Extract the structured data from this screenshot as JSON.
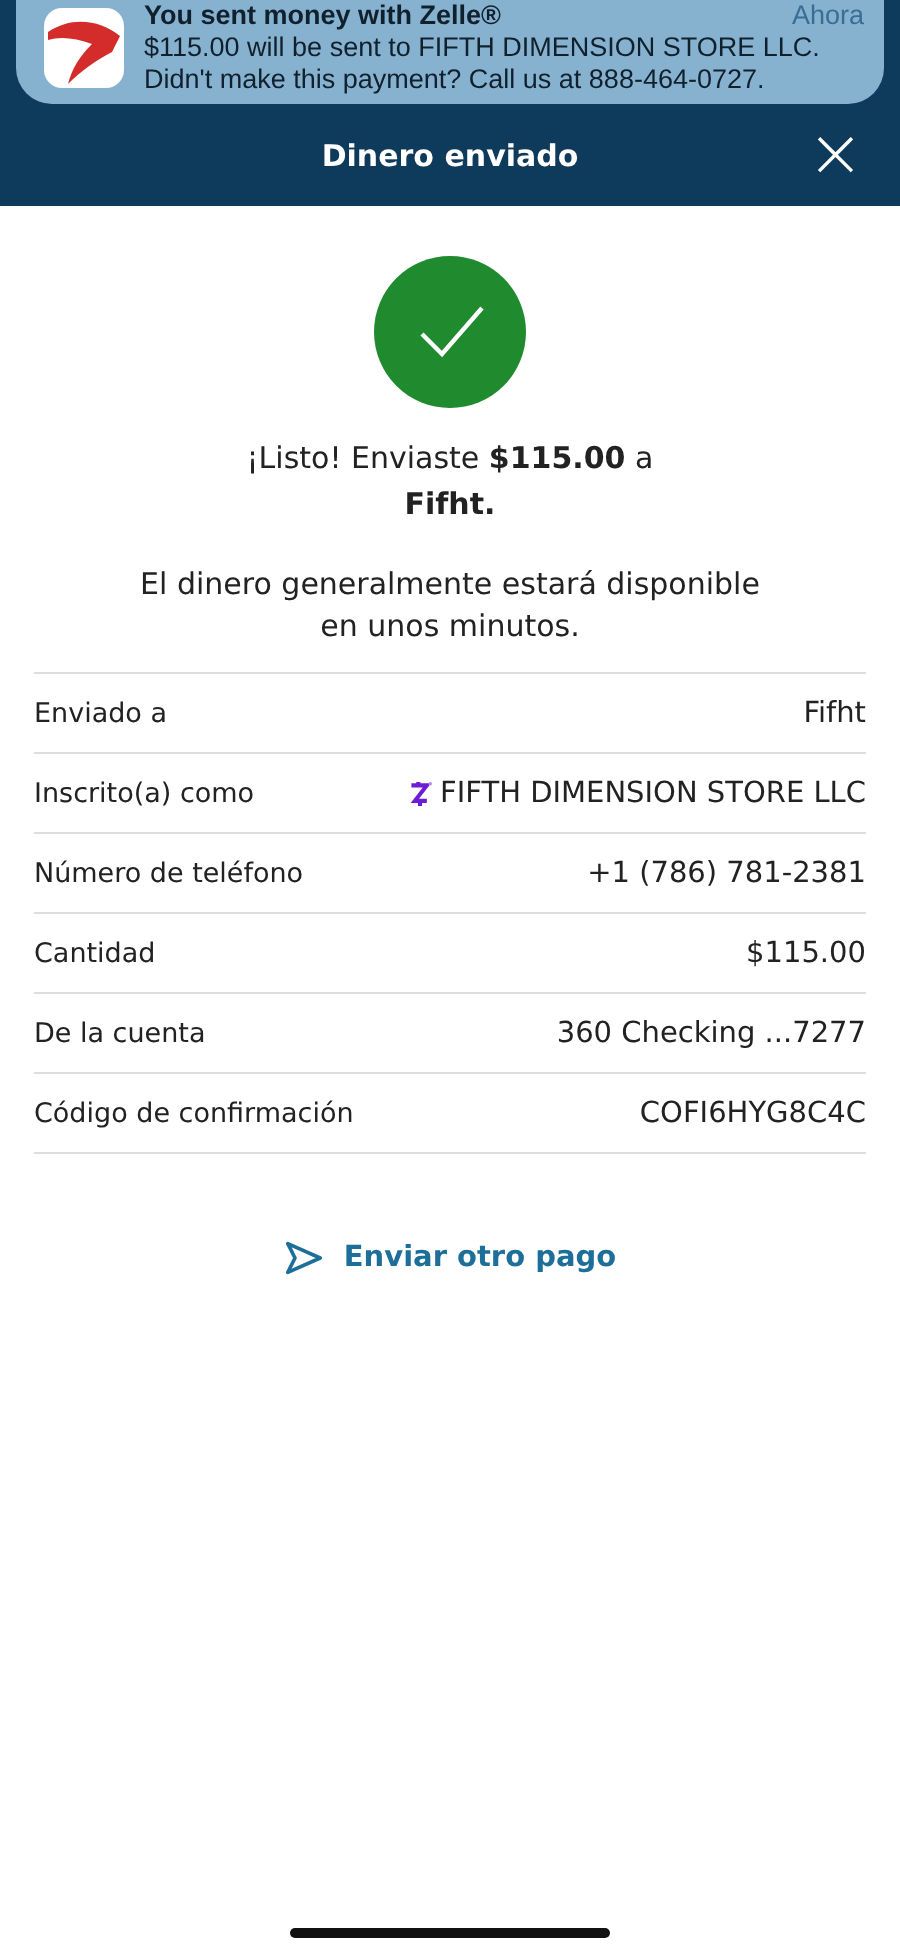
{
  "notification": {
    "title": "You sent money with Zelle®",
    "time": "Ahora",
    "lines": [
      "$115.00 will be sent to FIFTH DIMENSION STORE LLC.",
      "Didn't make this payment? Call us at 888-464-0727."
    ]
  },
  "header": {
    "title": "Dinero enviado",
    "close": "×"
  },
  "confirmation": "¡Listo! Enviaste **$115.00** a **Fifht.**",
  "availability": "El dinero generalmente estará disponible en unos minutos.",
  "details": [
    {
      "kind": "plain",
      "label": "Enviado a",
      "value": "Fifht"
    },
    {
      "kind": "enrolled",
      "label": "Inscrito(a) como",
      "value": "FIFTH DIMENSION STORE LLC"
    },
    {
      "kind": "plain",
      "label": "Número de teléfono",
      "value": "+1 (786) 781-2381"
    },
    {
      "kind": "plain",
      "label": "Cantidad",
      "value": "$115.00"
    },
    {
      "kind": "plain",
      "label": "De la cuenta",
      "value": "360 Checking ...7277"
    },
    {
      "kind": "plain",
      "label": "Código de confirmación",
      "value": "COFI6HYG8C4C"
    }
  ],
  "action": "Enviar otro pago"
}
